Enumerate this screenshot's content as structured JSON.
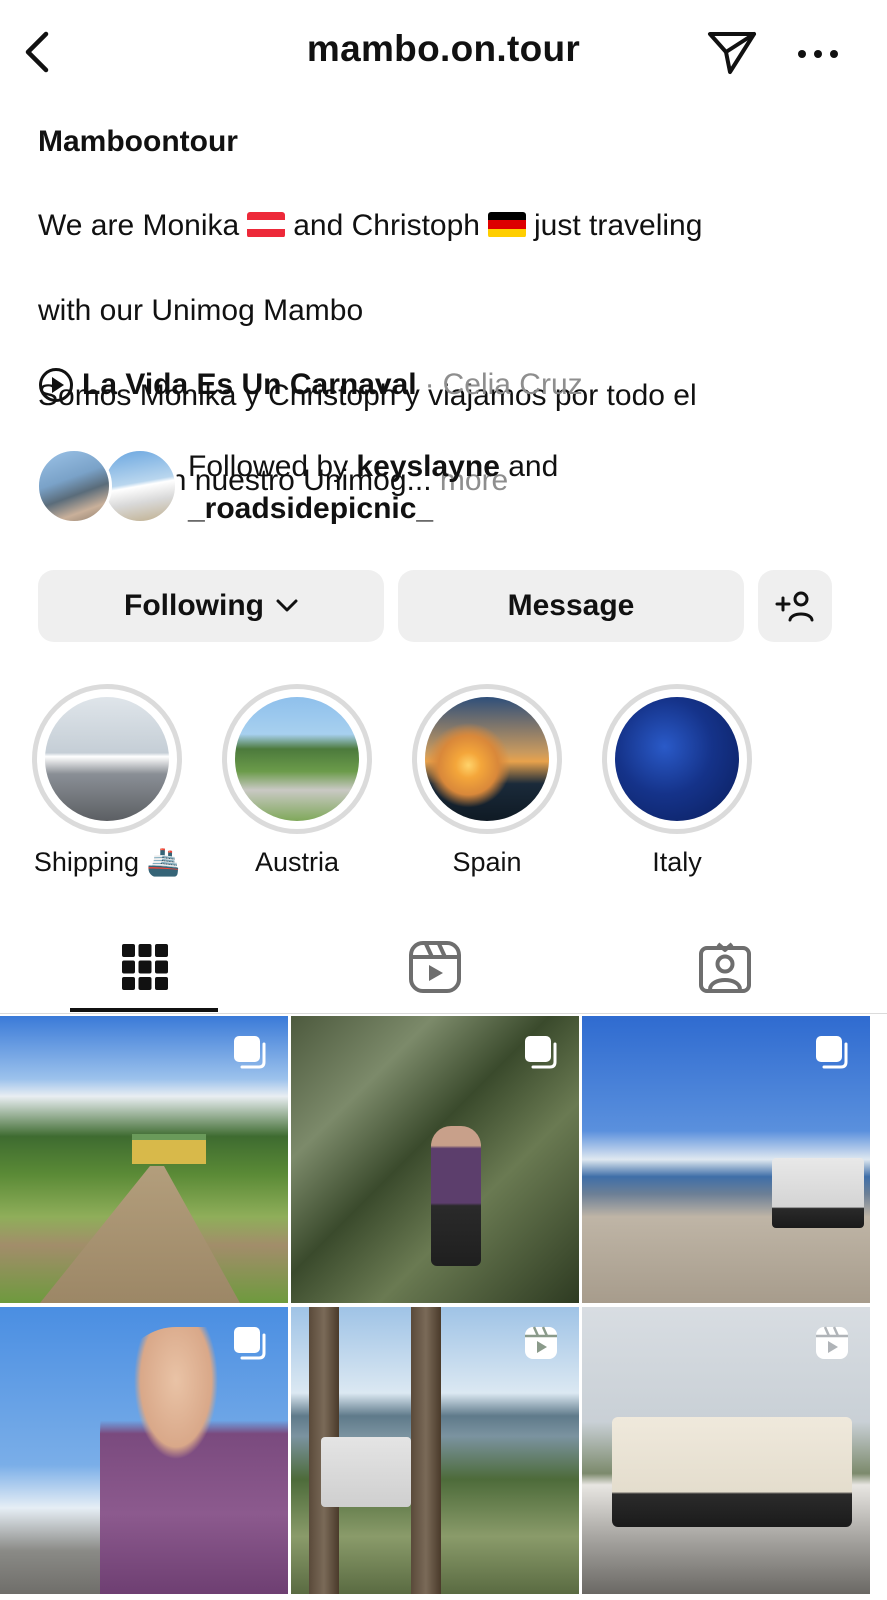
{
  "header": {
    "username": "mambo.on.tour"
  },
  "bio": {
    "name": "Mamboontour",
    "line1_a": "We are Monika",
    "line1_b": "and Christoph",
    "line1_c": "just traveling",
    "line2": "with our Unimog Mambo",
    "line3": "Somos Monika y Christoph y viajamos por todo el",
    "line4": "mundo con nuestro Unimog...",
    "more": "more"
  },
  "music": {
    "title": "La Vida Es Un Carnaval",
    "separator": "·",
    "artist": "Celia Cruz"
  },
  "followed_by": {
    "prefix": "Followed by",
    "user1": "keyslayne",
    "conjunction": "and",
    "user2": "_roadsidepicnic_"
  },
  "actions": {
    "following": "Following",
    "message": "Message"
  },
  "highlights": [
    {
      "label": "Shipping 🚢"
    },
    {
      "label": "Austria"
    },
    {
      "label": "Spain"
    },
    {
      "label": "Italy"
    }
  ],
  "tabs": {
    "active": "grid",
    "items": [
      "grid-icon",
      "reels-icon",
      "tagged-icon"
    ]
  },
  "posts": [
    {
      "type": "carousel"
    },
    {
      "type": "carousel"
    },
    {
      "type": "carousel"
    },
    {
      "type": "carousel"
    },
    {
      "type": "reel"
    },
    {
      "type": "reel"
    }
  ],
  "colors": {
    "text": "#111111",
    "muted": "#8e8e8e",
    "button_bg": "#efefef",
    "ring": "#dbdbdb"
  }
}
